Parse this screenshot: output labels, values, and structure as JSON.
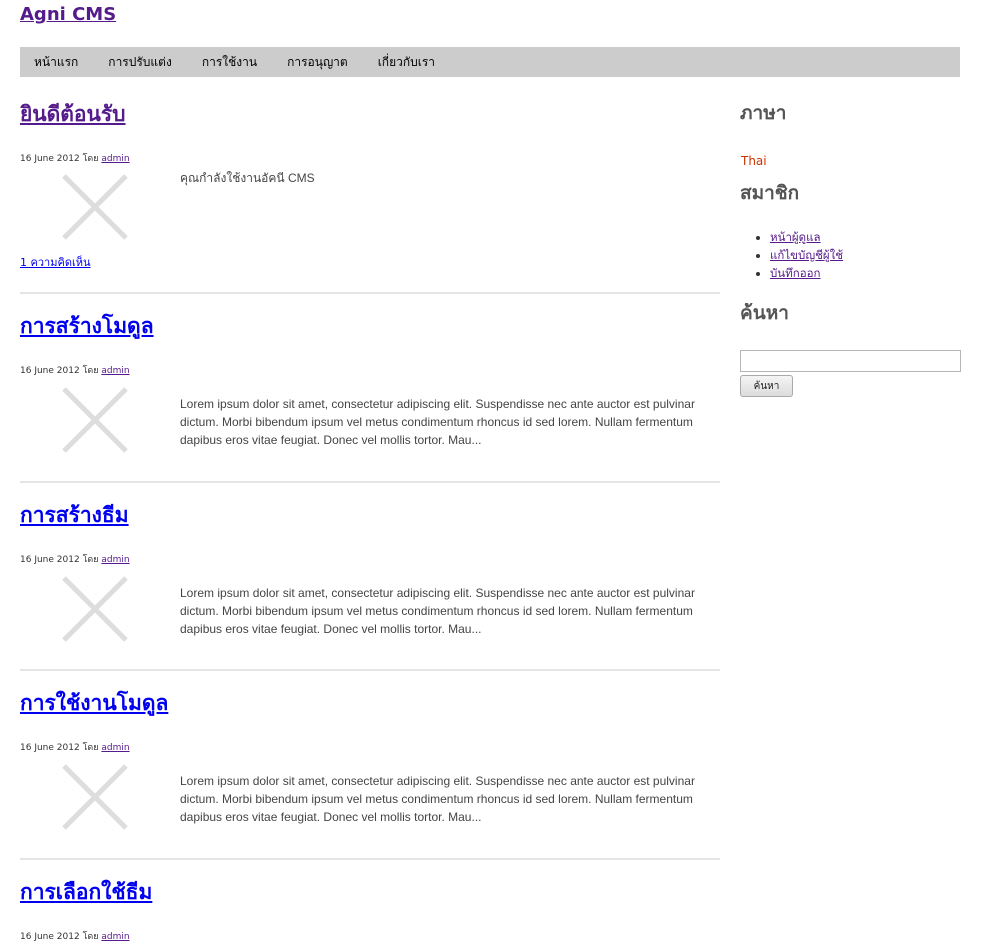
{
  "site": {
    "title": "Agni CMS"
  },
  "nav": {
    "items": [
      {
        "label": "หน้าแรก"
      },
      {
        "label": "การปรับแต่ง"
      },
      {
        "label": "การใช้งาน"
      },
      {
        "label": "การอนุญาต"
      },
      {
        "label": "เกี่ยวกับเรา"
      }
    ]
  },
  "posts": [
    {
      "title": "ยินดีต้อนรับ",
      "date": "16 June 2012",
      "by": "โดย",
      "author": "admin",
      "excerpt": "คุณกำลังใช้งานอัคนี CMS",
      "comments": "1 ความคิดเห็น"
    },
    {
      "title": "การสร้างโมดูล",
      "date": "16 June 2012",
      "by": "โดย",
      "author": "admin",
      "excerpt": "Lorem ipsum dolor sit amet, consectetur adipiscing elit. Suspendisse nec ante auctor est pulvinar dictum. Morbi bibendum ipsum vel metus condimentum rhoncus id sed lorem. Nullam fermentum dapibus eros vitae feugiat. Donec vel mollis tortor. Mau..."
    },
    {
      "title": "การสร้างธีม",
      "date": "16 June 2012",
      "by": "โดย",
      "author": "admin",
      "excerpt": "Lorem ipsum dolor sit amet, consectetur adipiscing elit. Suspendisse nec ante auctor est pulvinar dictum. Morbi bibendum ipsum vel metus condimentum rhoncus id sed lorem. Nullam fermentum dapibus eros vitae feugiat. Donec vel mollis tortor. Mau..."
    },
    {
      "title": "การใช้งานโมดูล",
      "date": "16 June 2012",
      "by": "โดย",
      "author": "admin",
      "excerpt": "Lorem ipsum dolor sit amet, consectetur adipiscing elit. Suspendisse nec ante auctor est pulvinar dictum. Morbi bibendum ipsum vel metus condimentum rhoncus id sed lorem. Nullam fermentum dapibus eros vitae feugiat. Donec vel mollis tortor. Mau..."
    },
    {
      "title": "การเลือกใช้ธีม",
      "date": "16 June 2012",
      "by": "โดย",
      "author": "admin"
    }
  ],
  "sidebar": {
    "language_heading": "ภาษา",
    "language_value": "Thai",
    "member_heading": "สมาชิก",
    "member_links": [
      {
        "label": "หน้าผู้ดูแล"
      },
      {
        "label": "แก้ไขบัญชีผู้ใช้"
      },
      {
        "label": "บันทึกออก"
      }
    ],
    "search_heading": "ค้นหา",
    "search_value": "",
    "search_button": "ค้นหา"
  },
  "colors": {
    "nav_bg": "#cccccc",
    "link": "#0000ee",
    "visited": "#551a8b",
    "language": "#cc3300",
    "placeholder_icon": "#dddddd"
  },
  "icons": {
    "thumbnail": "image-placeholder-x-icon"
  }
}
